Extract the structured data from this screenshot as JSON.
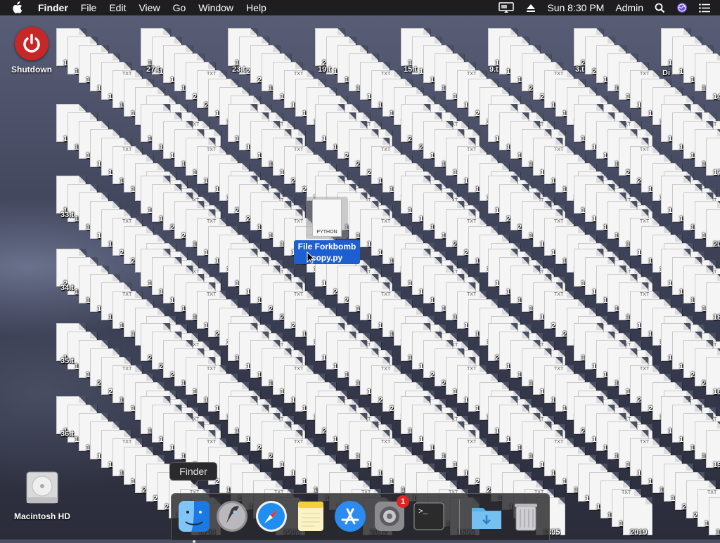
{
  "menubar": {
    "app_name": "Finder",
    "menus": [
      "File",
      "Edit",
      "View",
      "Go",
      "Window",
      "Help"
    ],
    "clock": "Sun 8:30 PM",
    "user": "Admin",
    "status_icons": [
      "airplay-display-icon",
      "eject-icon",
      "search-icon",
      "siri-icon",
      "control-list-icon"
    ]
  },
  "desktop": {
    "shutdown_label": "Shutdown",
    "disk_label": "Macintosh HD",
    "selected_file": {
      "name": "File Forkbomb copy.py",
      "kind": "PYTHON"
    },
    "partial_labels": [
      "Di"
    ],
    "column_heads": [
      "27.t",
      "23.t",
      "19.t",
      "15.t",
      "9.t",
      "3.t"
    ],
    "row_heads": [
      "33.t",
      "34.t",
      "35.t",
      "36.t"
    ],
    "file_numbers": [
      "1203",
      "1251",
      "1299",
      "1347",
      "1395",
      "1443",
      "1491",
      "1539",
      "1587",
      "1635",
      "1683",
      "1731",
      "1779",
      "1827",
      "1875",
      "1923",
      "1971",
      "2019",
      "2067",
      "1630",
      "1678",
      "1726",
      "1774",
      "1822",
      "1870",
      "1918",
      "1966",
      "2014",
      "2062",
      "1625",
      "1673",
      "1721",
      "1769",
      "1817",
      "1865",
      "1913",
      "1961",
      "2009",
      "2057",
      "2105",
      "1668",
      "1716",
      "1764",
      "1812",
      "1860",
      "1908",
      "1956",
      "2004",
      "2052",
      "2100",
      "1663",
      "1711",
      "1759",
      "1807",
      "1855",
      "1903",
      "1951",
      "1999",
      "2047",
      "2095",
      "1658",
      "1706",
      "1754",
      "1802",
      "1850",
      "1898",
      "1946",
      "1994",
      "2042",
      "2090",
      "1653",
      "1701",
      "1749",
      "1797",
      "1845",
      "1893",
      "1941",
      "1989",
      "2037",
      "2085",
      "1648",
      "1696",
      "1744",
      "1792",
      "1840",
      "1888",
      "1936",
      "1984",
      "2032",
      "2080"
    ],
    "ext_label": "TXT"
  },
  "dock": {
    "tooltip": "Finder",
    "apps": [
      {
        "name": "Finder",
        "icon": "finder-icon"
      },
      {
        "name": "Launchpad",
        "icon": "launchpad-icon"
      },
      {
        "name": "Safari",
        "icon": "safari-icon"
      },
      {
        "name": "Notes",
        "icon": "notes-icon"
      },
      {
        "name": "App Store",
        "icon": "app-store-icon"
      },
      {
        "name": "System Preferences",
        "icon": "system-preferences-icon",
        "badge": "1"
      },
      {
        "name": "Terminal",
        "icon": "terminal-icon"
      },
      {
        "name": "Downloads",
        "icon": "downloads-folder-icon"
      },
      {
        "name": "Trash",
        "icon": "trash-icon"
      }
    ],
    "terminal_prompt": ">_"
  },
  "colors": {
    "menubar": "#1e1e20",
    "selection": "#1d5fd1",
    "shutdown_red": "#c62828",
    "badge_red": "#e0241f"
  }
}
